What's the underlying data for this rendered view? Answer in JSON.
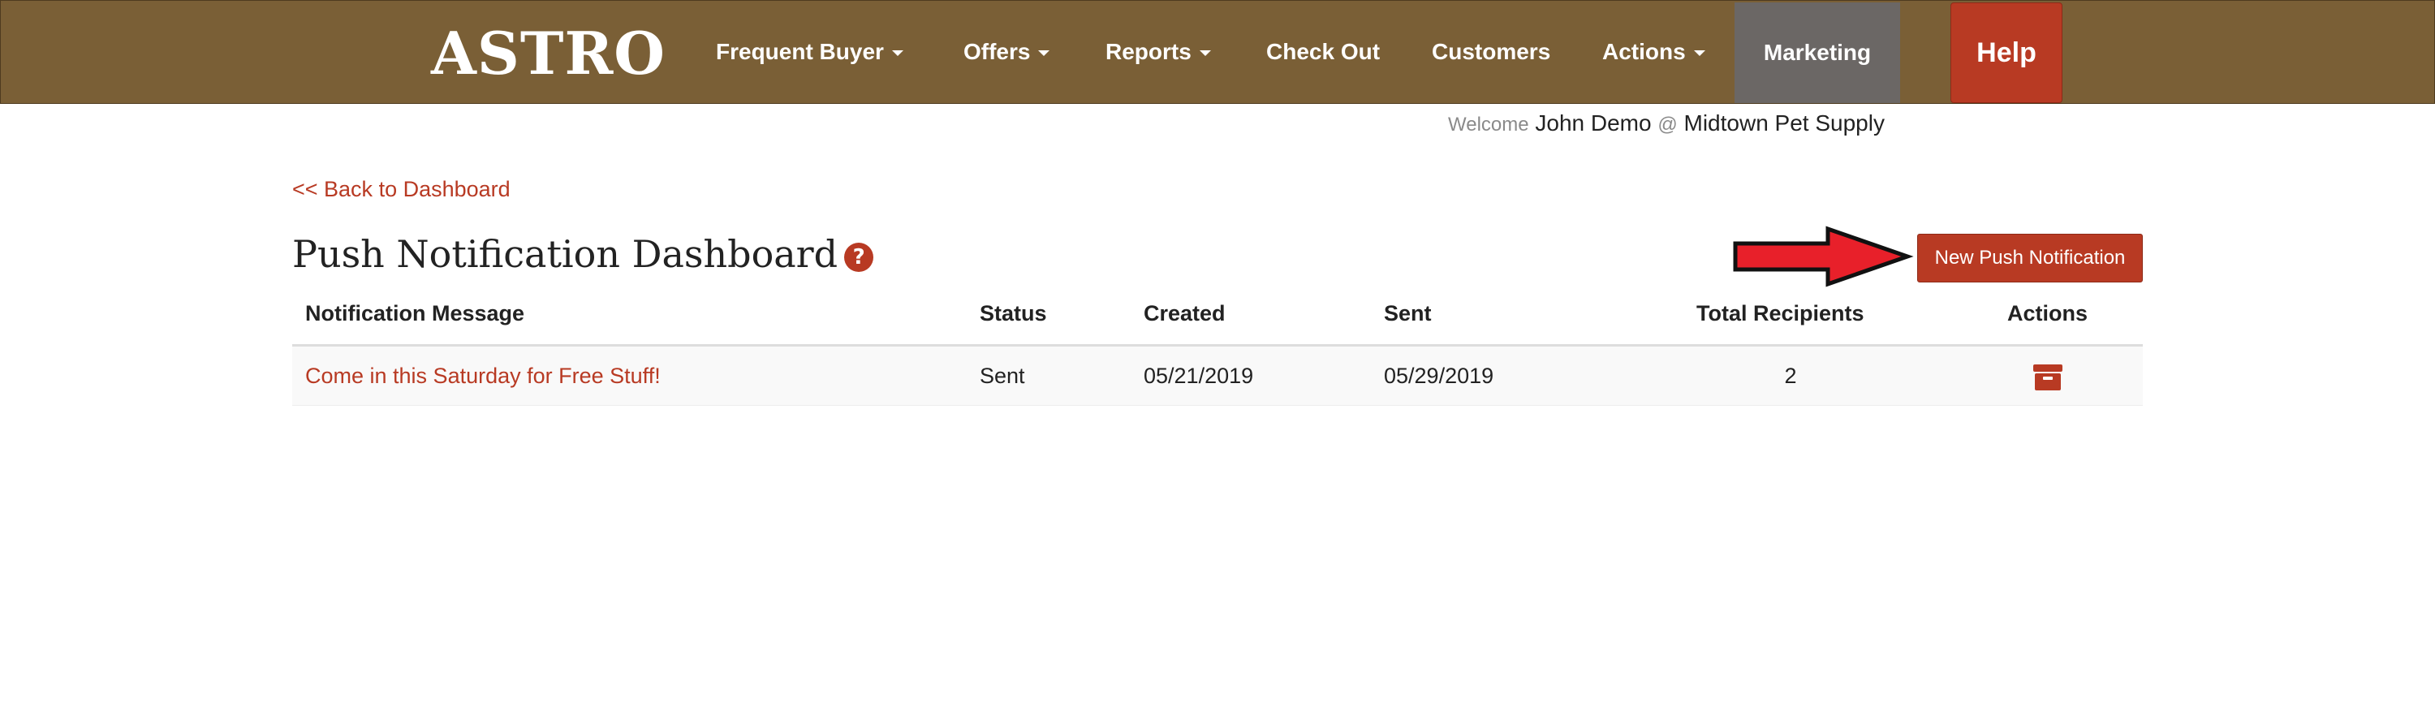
{
  "app": {
    "logo_text": "ASTRO"
  },
  "nav": {
    "frequent_buyer": "Frequent Buyer",
    "offers": "Offers",
    "reports": "Reports",
    "check_out": "Check Out",
    "customers": "Customers",
    "actions": "Actions",
    "marketing": "Marketing",
    "help": "Help"
  },
  "welcome": {
    "prefix": "Welcome",
    "user": "John Demo",
    "at": "@",
    "store": "Midtown Pet Supply"
  },
  "back_link": "<< Back to Dashboard",
  "page_title": "Push Notification Dashboard",
  "help_icon_glyph": "?",
  "new_button_label": "New Push Notification",
  "colors": {
    "brand_bar": "#7a5f36",
    "accent": "#b83a23",
    "marketing_active": "#6b6765",
    "arrow": "#e8202a"
  },
  "icons": {
    "help": "question-circle-icon",
    "archive": "archive-icon",
    "caret": "caret-down-icon",
    "arrow": "arrow-right-icon"
  },
  "table": {
    "headers": {
      "message": "Notification Message",
      "status": "Status",
      "created": "Created",
      "sent": "Sent",
      "recipients": "Total Recipients",
      "actions": "Actions"
    },
    "rows": [
      {
        "message": "Come in this Saturday for Free Stuff!",
        "status": "Sent",
        "created": "05/21/2019",
        "sent": "05/29/2019",
        "recipients": "2"
      }
    ]
  }
}
